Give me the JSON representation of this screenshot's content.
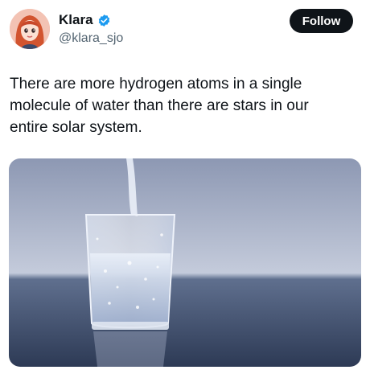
{
  "author": {
    "name": "Klara",
    "handle": "@klara_sjo",
    "verified": true,
    "avatar_icon": "avatar-illustration"
  },
  "follow_button": {
    "label": "Follow"
  },
  "tweet": {
    "lines": [
      "There are more hydrogen atoms in a single",
      "molecule of water than there are stars in our",
      "entire solar system."
    ]
  },
  "media": {
    "icon": "glass-of-water-image"
  },
  "colors": {
    "text": "#0f1419",
    "muted": "#536471",
    "verified_blue": "#1d9bf0",
    "button_bg": "#0f1419"
  }
}
